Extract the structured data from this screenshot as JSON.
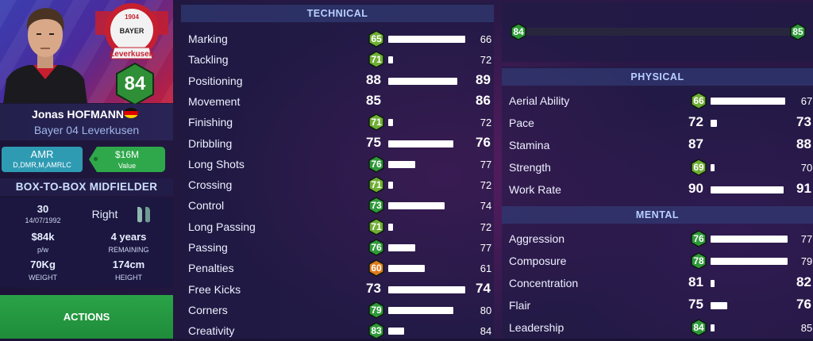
{
  "player": {
    "first_name": "Jonas",
    "last_name": "HOFMANN",
    "club": "Bayer 04 Leverkusen",
    "overall": "84",
    "position": "AMR",
    "positions_alt": "D,DMR,M,AMRLC",
    "value": "$16M",
    "value_label": "Value",
    "role": "BOX-TO-BOX MIDFIELDER",
    "age": "30",
    "dob": "14/07/1992",
    "foot": "Right",
    "wage": "$84k",
    "wage_label": "p/w",
    "contract": "4 years",
    "contract_label": "REMAINING",
    "weight": "70Kg",
    "weight_label": "WEIGHT",
    "height": "174cm",
    "height_label": "HEIGHT"
  },
  "badge_text": {
    "year": "1904",
    "club_word": "BAYER",
    "city": "Leverkusen"
  },
  "actions_label": "ACTIONS",
  "colors": {
    "rating_high": "#2f9a3a",
    "rating_avg": "#6fae34",
    "rating_low": "#e07a1c",
    "accent_green": "#2ea84a",
    "accent_teal": "#2e9bb3"
  },
  "technical": {
    "title": "TECHNICAL",
    "attrs": [
      {
        "name": "Marking",
        "cur": "65",
        "pot": "66",
        "progress": 0.95
      },
      {
        "name": "Tackling",
        "cur": "71",
        "pot": "72",
        "progress": 0.06
      },
      {
        "name": "Positioning",
        "cur": "88",
        "pot": "89",
        "progress": 0.85
      },
      {
        "name": "Movement",
        "cur": "85",
        "pot": "86",
        "progress": 0.0
      },
      {
        "name": "Finishing",
        "cur": "71",
        "pot": "72",
        "progress": 0.06
      },
      {
        "name": "Dribbling",
        "cur": "75",
        "pot": "76",
        "progress": 0.8
      },
      {
        "name": "Long Shots",
        "cur": "76",
        "pot": "77",
        "progress": 0.33
      },
      {
        "name": "Crossing",
        "cur": "71",
        "pot": "72",
        "progress": 0.06
      },
      {
        "name": "Control",
        "cur": "73",
        "pot": "74",
        "progress": 0.7
      },
      {
        "name": "Long Passing",
        "cur": "71",
        "pot": "72",
        "progress": 0.06
      },
      {
        "name": "Passing",
        "cur": "76",
        "pot": "77",
        "progress": 0.33
      },
      {
        "name": "Penalties",
        "cur": "60",
        "pot": "61",
        "progress": 0.45
      },
      {
        "name": "Free Kicks",
        "cur": "73",
        "pot": "74",
        "progress": 0.95
      },
      {
        "name": "Corners",
        "cur": "79",
        "pot": "80",
        "progress": 0.8
      },
      {
        "name": "Creativity",
        "cur": "83",
        "pot": "84",
        "progress": 0.2
      }
    ]
  },
  "overall_bar": {
    "cur": "84",
    "pot": "85",
    "progress": 0.0
  },
  "physical": {
    "title": "PHYSICAL",
    "attrs": [
      {
        "name": "Aerial Ability",
        "cur": "66",
        "pot": "67",
        "progress": 0.9
      },
      {
        "name": "Pace",
        "cur": "72",
        "pot": "73",
        "progress": 0.08
      },
      {
        "name": "Stamina",
        "cur": "87",
        "pot": "88",
        "progress": 0.0
      },
      {
        "name": "Strength",
        "cur": "69",
        "pot": "70",
        "progress": 0.05
      },
      {
        "name": "Work Rate",
        "cur": "90",
        "pot": "91",
        "progress": 0.88
      }
    ]
  },
  "mental": {
    "title": "MENTAL",
    "attrs": [
      {
        "name": "Aggression",
        "cur": "76",
        "pot": "77",
        "progress": 0.93
      },
      {
        "name": "Composure",
        "cur": "78",
        "pot": "79",
        "progress": 0.93
      },
      {
        "name": "Concentration",
        "cur": "81",
        "pot": "82",
        "progress": 0.05
      },
      {
        "name": "Flair",
        "cur": "75",
        "pot": "76",
        "progress": 0.2
      },
      {
        "name": "Leadership",
        "cur": "84",
        "pot": "85",
        "progress": 0.04
      }
    ]
  }
}
